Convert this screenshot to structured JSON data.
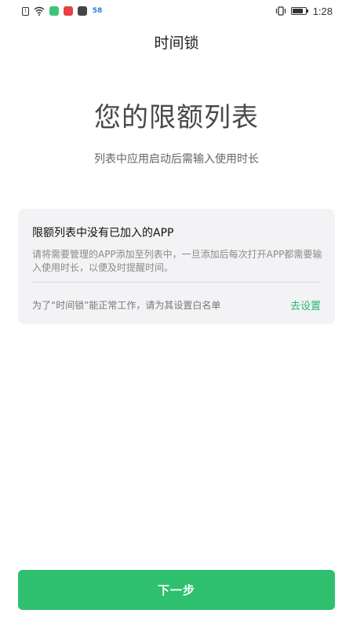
{
  "status_bar": {
    "time": "1:28",
    "sim_label": "!",
    "left_icons": [
      {
        "name": "sim-alert-icon",
        "color": "#333333"
      },
      {
        "name": "wifi-icon",
        "color": "#333333"
      },
      {
        "name": "green-app-icon",
        "color": "#3cc47c"
      },
      {
        "name": "red-app-icon",
        "color": "#e8413e"
      },
      {
        "name": "dark-app-icon",
        "color": "#444444"
      },
      {
        "name": "app-58-icon",
        "color": "#2a7ae2"
      }
    ],
    "app_58_label": "58",
    "right_icons": [
      "vibrate-icon",
      "battery-icon"
    ],
    "battery_level": 0.85
  },
  "header": {
    "app_title": "时间锁"
  },
  "hero": {
    "title": "您的限额列表",
    "subtitle": "列表中应用启动后需输入使用时长"
  },
  "card": {
    "title": "限额列表中没有已加入的APP",
    "description": "请将需要管理的APP添加至列表中，一旦添加后每次打开APP都需要输入使用时长，以便及时提醒时间。",
    "whitelist_note": "为了“时间锁”能正常工作，请为其设置白名单",
    "go_settings_label": "去设置"
  },
  "footer": {
    "next_label": "下一步"
  },
  "colors": {
    "accent": "#2ec06e",
    "link": "#2bb673",
    "card_bg": "#f3f3f5"
  }
}
